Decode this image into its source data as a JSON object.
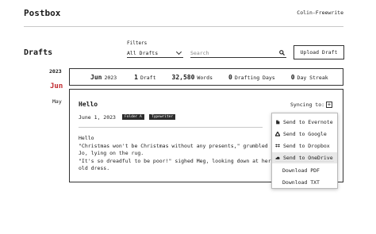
{
  "header": {
    "brand": "Postbox",
    "user": "Colin-Freewrite"
  },
  "section": {
    "title": "Drafts"
  },
  "filters": {
    "label": "Filters",
    "selected": "All Drafts"
  },
  "search": {
    "placeholder": "Search"
  },
  "toolbar": {
    "upload_label": "Upload Draft"
  },
  "timeline": {
    "year": "2023",
    "active_month": "Jun",
    "other_month": "May"
  },
  "stats": {
    "month": "Jun",
    "year": "2023",
    "drafts_value": "1",
    "drafts_label": "Draft",
    "words_value": "32,580",
    "words_label": "Words",
    "drafting_value": "0",
    "drafting_label": "Drafting Days",
    "streak_value": "0",
    "streak_label": "Day Streak"
  },
  "draft": {
    "title": "Hello",
    "date": "June 1, 2023",
    "tags": [
      "Folder A",
      "Typewriter"
    ],
    "body": "Hello\n\"Christmas won't be Christmas without any presents,\" grumbled Jo, lying on the rug.\n\"It's so dreadful to be poor!\" sighed Meg, looking down at her old dress."
  },
  "sync": {
    "label": "Syncing to:",
    "plus": "+"
  },
  "menu": {
    "items": [
      {
        "label": "Send to Evernote",
        "icon": "evernote-icon"
      },
      {
        "label": "Send to Google",
        "icon": "google-icon"
      },
      {
        "label": "Send to Dropbox",
        "icon": "dropbox-icon"
      },
      {
        "label": "Send to OneDrive",
        "icon": "onedrive-icon"
      },
      {
        "label": "Download PDF"
      },
      {
        "label": "Download TXT"
      }
    ]
  }
}
